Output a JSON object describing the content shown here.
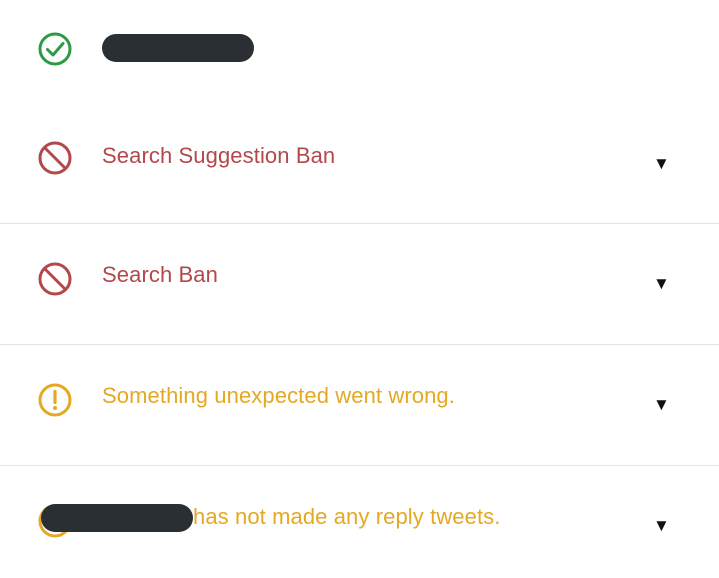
{
  "results": [
    {
      "status": "ok",
      "icon": "check-circle-icon",
      "label": "",
      "color": "#2e9a46"
    },
    {
      "status": "ban",
      "icon": "ban-icon",
      "label": "Search Suggestion Ban",
      "color": "#b3484b",
      "expand_glyph": "▼"
    },
    {
      "status": "ban",
      "icon": "ban-icon",
      "label": "Search Ban",
      "color": "#b3484b",
      "expand_glyph": "▼"
    },
    {
      "status": "warning",
      "icon": "exclamation-circle-icon",
      "label": "Something unexpected went wrong.",
      "color": "#e4a823",
      "expand_glyph": "▼"
    },
    {
      "status": "warning",
      "icon": "warning-circle-icon",
      "label": "has not made any reply tweets.",
      "color": "#e4a823",
      "expand_glyph": "▼"
    }
  ]
}
